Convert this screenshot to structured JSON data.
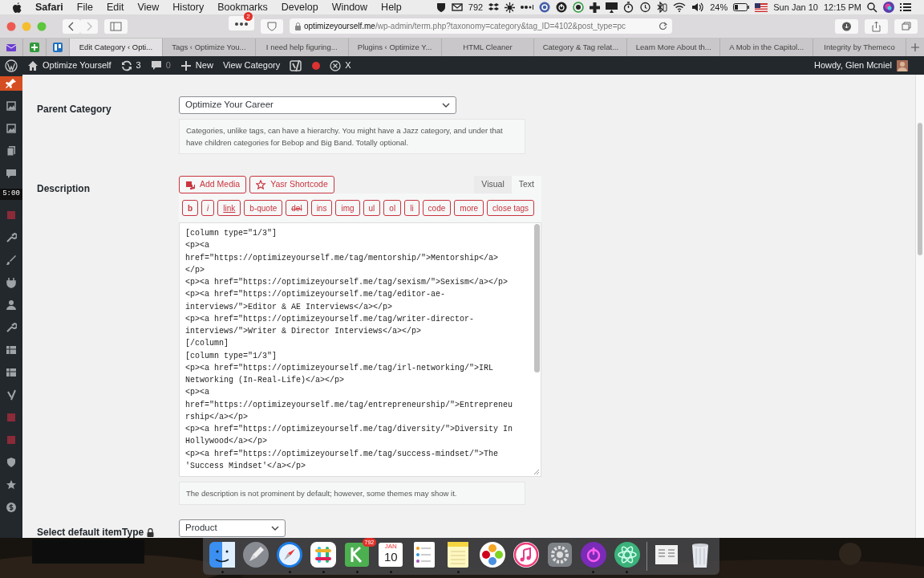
{
  "menu_bar": {
    "app": "Safari",
    "menus": [
      "File",
      "Edit",
      "View",
      "History",
      "Bookmarks",
      "Develop",
      "Window",
      "Help"
    ],
    "mail_count": "792",
    "battery": "24%",
    "date": "Sun Jan 10",
    "time": "12:15 PM"
  },
  "toolbar": {
    "extension_badge": "2",
    "url_host": "optimizeyourself.me",
    "url_path": "/wp-admin/term.php?taxonomy=category&tag_ID=4102&post_type=pc"
  },
  "tabs": [
    {
      "label": "Edit Category ‹ Opti...",
      "selected": true
    },
    {
      "label": "Tags ‹ Optimize You...",
      "selected": false
    },
    {
      "label": "I need help figuring...",
      "selected": false
    },
    {
      "label": "Plugins ‹ Optimize Y...",
      "selected": false
    },
    {
      "label": "HTML Cleaner",
      "selected": false
    },
    {
      "label": "Category & Tag relat...",
      "selected": false
    },
    {
      "label": "Learn More About th...",
      "selected": false
    },
    {
      "label": "A Mob in the Capitol...",
      "selected": false
    },
    {
      "label": "Integrity by Themeco",
      "selected": false
    }
  ],
  "admin_bar": {
    "site": "Optimize Yourself",
    "updates": "3",
    "comments": "0",
    "new": "New",
    "view": "View Category",
    "close": "X",
    "greeting": "Howdy, Glen Mcniel"
  },
  "sidebar": {
    "timer": "5:00",
    "items": [
      {
        "kind": "pin",
        "selected": true
      },
      {
        "kind": "media",
        "selected": false
      },
      {
        "kind": "media",
        "selected": false
      },
      {
        "kind": "pages",
        "selected": false
      },
      {
        "kind": "comment",
        "selected": false
      },
      {
        "kind": "square",
        "selected": false
      },
      {
        "kind": "tool",
        "selected": false
      },
      {
        "kind": "brush",
        "selected": false
      },
      {
        "kind": "plug",
        "selected": false
      },
      {
        "kind": "user",
        "selected": false
      },
      {
        "kind": "tool",
        "selected": false
      },
      {
        "kind": "grid",
        "selected": false
      },
      {
        "kind": "grid",
        "selected": false
      },
      {
        "kind": "yoast",
        "selected": false
      },
      {
        "kind": "square",
        "selected": false
      },
      {
        "kind": "square",
        "selected": false
      },
      {
        "kind": "shield",
        "selected": false
      },
      {
        "kind": "star",
        "selected": false
      },
      {
        "kind": "dollar",
        "selected": false
      }
    ]
  },
  "form": {
    "parent": {
      "label": "Parent Category",
      "value": "Optimize Your Career",
      "help": "Categories, unlike tags, can have a hierarchy. You might have a Jazz category, and under that have children categories for Bebop and Big Band. Totally optional."
    },
    "description": {
      "label": "Description",
      "media_buttons": [
        "Add Media",
        "Yasr Shortcode"
      ],
      "modes": [
        {
          "label": "Visual",
          "selected": false
        },
        {
          "label": "Text",
          "selected": true
        }
      ],
      "quicktags": [
        {
          "label": "b",
          "kind": "bold"
        },
        {
          "label": "i",
          "kind": "italic"
        },
        {
          "label": "link",
          "kind": "link"
        },
        {
          "label": "b-quote",
          "kind": "plain"
        },
        {
          "label": "del",
          "kind": "strike"
        },
        {
          "label": "ins",
          "kind": "plain"
        },
        {
          "label": "img",
          "kind": "plain"
        },
        {
          "label": "ul",
          "kind": "plain"
        },
        {
          "label": "ol",
          "kind": "plain"
        },
        {
          "label": "li",
          "kind": "plain"
        },
        {
          "label": "code",
          "kind": "plain"
        },
        {
          "label": "more",
          "kind": "plain"
        },
        {
          "label": "close tags",
          "kind": "plain"
        }
      ],
      "code_lines": [
        "[column type=\"1/3\"]",
        "<p><a",
        "href=\"https://optimizeyourself.me/tag/mentorship/\">Mentorship</a>",
        "</p>",
        "<p><a href=\"https://optimizeyourself.me/tag/sexism/\">Sexism</a></p>",
        "<p><a href=\"https://optimizeyourself.me/tag/editor-ae-",
        "interviews/\">Editor & AE Interviews</a></p>",
        "<p><a href=\"https://optimizeyourself.me/tag/writer-director-",
        "interviews/\">Writer & Director Interviews</a></p>",
        "[/column]",
        "[column type=\"1/3\"]",
        "<p><a href=\"https://optimizeyourself.me/tag/irl-networking/\">IRL",
        "Networking (In-Real-Life)</a></p>",
        "<p><a",
        "href=\"https://optimizeyourself.me/tag/entrepreneurship/\">Entrepreneu",
        "rship</a></p>",
        "<p><a href=\"https://optimizeyourself.me/tag/diversity/\">Diversity In",
        "Hollywood</a></p>",
        "<p><a href=\"https://optimizeyourself.me/tag/success-mindset/\">The",
        "'Success Mindset'</a></p>"
      ],
      "help": "The description is not prominent by default; however, some themes may show it."
    },
    "item_type": {
      "label": "Select default itemType",
      "value": "Product"
    }
  },
  "dock": [
    {
      "kind": "finder",
      "running": true
    },
    {
      "kind": "rocket",
      "running": false
    },
    {
      "kind": "compass",
      "running": true
    },
    {
      "kind": "slack",
      "running": true
    },
    {
      "kind": "k",
      "running": true,
      "badge": "792"
    },
    {
      "kind": "calendar",
      "running": true,
      "month": "JAN",
      "day": "10"
    },
    {
      "kind": "list",
      "running": false
    },
    {
      "kind": "notes",
      "running": true
    },
    {
      "kind": "photos",
      "running": false
    },
    {
      "kind": "music",
      "running": false
    },
    {
      "kind": "gear",
      "running": false
    },
    {
      "kind": "power",
      "running": true
    },
    {
      "kind": "atom",
      "running": true
    },
    {
      "kind": "divider"
    },
    {
      "kind": "preview",
      "running": false
    },
    {
      "kind": "trash",
      "running": false
    }
  ]
}
